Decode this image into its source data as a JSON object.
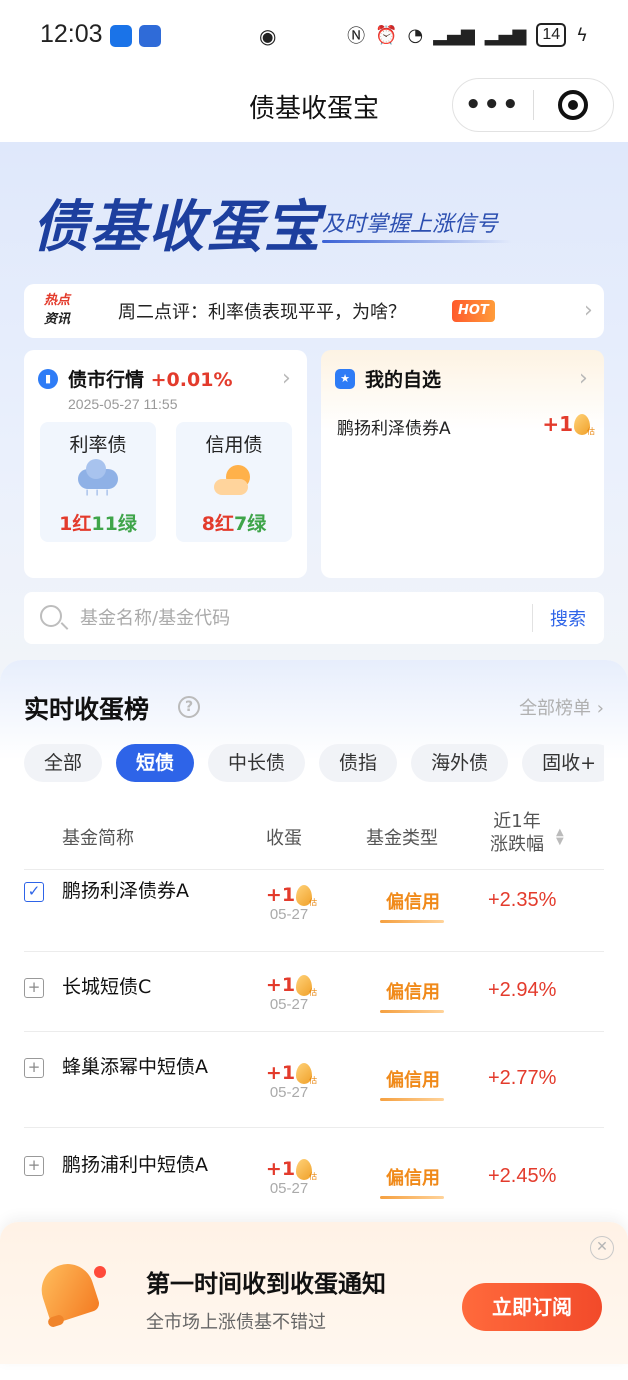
{
  "status_bar": {
    "time": "12:03",
    "battery": "14",
    "icons": [
      "app-icon-blue",
      "app-icon-blue-2",
      "eye-icon",
      "nfc-icon",
      "alarm-icon",
      "wifi-icon",
      "signal-icon",
      "signal-icon",
      "charging-icon"
    ]
  },
  "nav": {
    "title": "债基收蛋宝",
    "more_glyph": "•••"
  },
  "hero": {
    "brand": "债基收蛋宝",
    "slogan": "及时掌握上涨信号",
    "news": {
      "tag_line1": "热点",
      "tag_line2": "资讯",
      "text": "周二点评：利率债表现平平，为啥？",
      "badge": "HOT"
    }
  },
  "market": {
    "title": "债市行情",
    "change": "+0.01%",
    "time": "2025-05-27 11:55",
    "rate_bond": {
      "label": "利率债",
      "red": "1红",
      "green": "11绿",
      "weather": "rain-cloud-icon"
    },
    "credit_bond": {
      "label": "信用债",
      "red": "8红",
      "green": "7绿",
      "weather": "sun-cloud-icon"
    }
  },
  "watchlist": {
    "title": "我的自选",
    "fund": "鹏扬利泽债券A",
    "eggs": "+1",
    "egg_tag": "估"
  },
  "search": {
    "placeholder": "基金名称/基金代码",
    "button": "搜索"
  },
  "ranking": {
    "title": "实时收蛋榜",
    "help": "?",
    "all": "全部榜单",
    "tabs": [
      "全部",
      "短债",
      "中长债",
      "债指",
      "海外债",
      "固收+"
    ],
    "active_tab": "短债",
    "headers": {
      "name": "基金简称",
      "eggs": "收蛋",
      "type": "基金类型",
      "year_line1": "近1年",
      "year_line2": "涨跌幅"
    },
    "rows": [
      {
        "name": "鹏扬利泽债券A",
        "eggs": "+1",
        "egg_tag": "估",
        "date": "05-27",
        "type": "偏信用",
        "change": "+2.35%",
        "checked": true
      },
      {
        "name": "长城短债C",
        "eggs": "+1",
        "egg_tag": "估",
        "date": "05-27",
        "type": "偏信用",
        "change": "+2.94%",
        "checked": false
      },
      {
        "name": "蜂巢添幂中短债A",
        "eggs": "+1",
        "egg_tag": "估",
        "date": "05-27",
        "type": "偏信用",
        "change": "+2.77%",
        "checked": false
      },
      {
        "name": "鹏扬浦利中短债A",
        "eggs": "+1",
        "egg_tag": "估",
        "date": "05-27",
        "type": "偏信用",
        "change": "+2.45%",
        "checked": false
      }
    ]
  },
  "subscribe": {
    "title": "第一时间收到收蛋通知",
    "desc": "全市场上涨债基不错过",
    "button": "立即订阅"
  },
  "colors": {
    "accent": "#2e64e8",
    "up": "#e33b2c",
    "down": "#3fa54a",
    "credit": "#f08a1a"
  }
}
